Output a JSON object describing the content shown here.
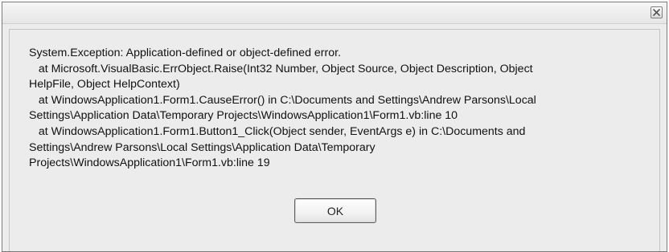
{
  "dialog": {
    "close_icon": "close-icon",
    "message_lines": [
      "System.Exception: Application-defined or object-defined error.",
      "   at Microsoft.VisualBasic.ErrObject.Raise(Int32 Number, Object Source, Object Description, Object",
      "HelpFile, Object HelpContext)",
      "   at WindowsApplication1.Form1.CauseError() in C:\\Documents and Settings\\Andrew Parsons\\Local",
      "Settings\\Application Data\\Temporary Projects\\WindowsApplication1\\Form1.vb:line 10",
      "   at WindowsApplication1.Form1.Button1_Click(Object sender, EventArgs e) in C:\\Documents and",
      "Settings\\Andrew Parsons\\Local Settings\\Application Data\\Temporary",
      "Projects\\WindowsApplication1\\Form1.vb:line 19"
    ],
    "ok_label": "OK"
  }
}
